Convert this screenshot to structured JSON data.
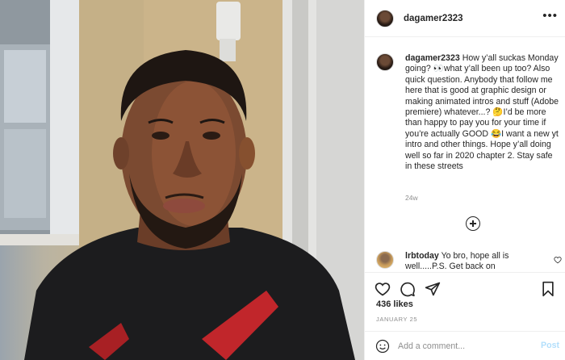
{
  "header": {
    "username": "dagamer2323",
    "more_icon": "more-horizontal-icon"
  },
  "caption": {
    "username": "dagamer2323",
    "text": "How y’all suckas Monday going? 👀what y’all been up too? Also quick question. Anybody that follow me here that is good at graphic design or making animated intros and stuff (Adobe premiere) whatever...? 🤔I’d be more than happy to pay you for your time if you’re actually GOOD 😂I want a new yt intro and other things. Hope y’all doing well so far in 2020 chapter 2. Stay safe in these streets",
    "timestamp": "24w"
  },
  "load_more_icon": "plus-circle-icon",
  "comments": [
    {
      "username": "lrbtoday",
      "text": "Yo bro, hope all is well.....P.S. Get back on"
    }
  ],
  "actions": {
    "icons": [
      "heart-icon",
      "comment-icon",
      "share-icon",
      "bookmark-icon"
    ]
  },
  "likes": "436 likes",
  "date": "JANUARY 25",
  "add_comment": {
    "placeholder": "Add a comment...",
    "post_label": "Post"
  },
  "colors": {
    "text": "#262626",
    "muted": "#8e8e8e",
    "post_disabled": "#b2dffc",
    "divider": "#efefef"
  }
}
